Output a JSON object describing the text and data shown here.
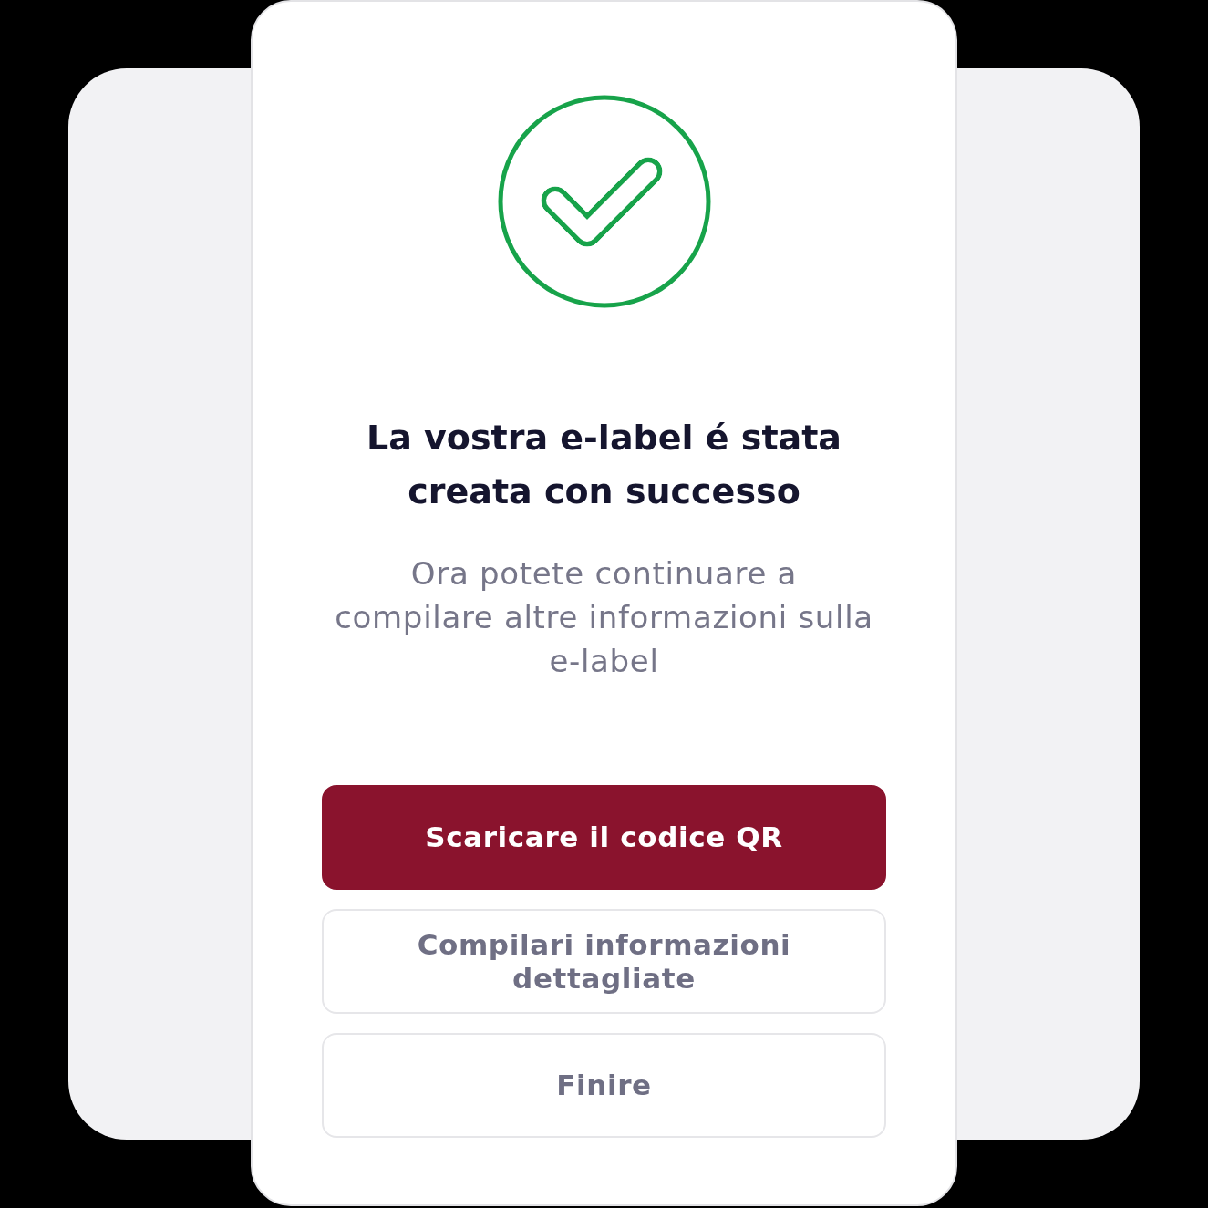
{
  "dialog": {
    "title": "La vostra e-label é stata creata con successo",
    "message": "Ora potete continuare a compilare altre informazioni sulla e-label",
    "buttons": [
      {
        "label": "Scaricare il codice QR",
        "kind": "primary"
      },
      {
        "label": "Compilari informazioni dettagliate",
        "kind": "secondary"
      },
      {
        "label": "Finire",
        "kind": "secondary"
      }
    ]
  }
}
